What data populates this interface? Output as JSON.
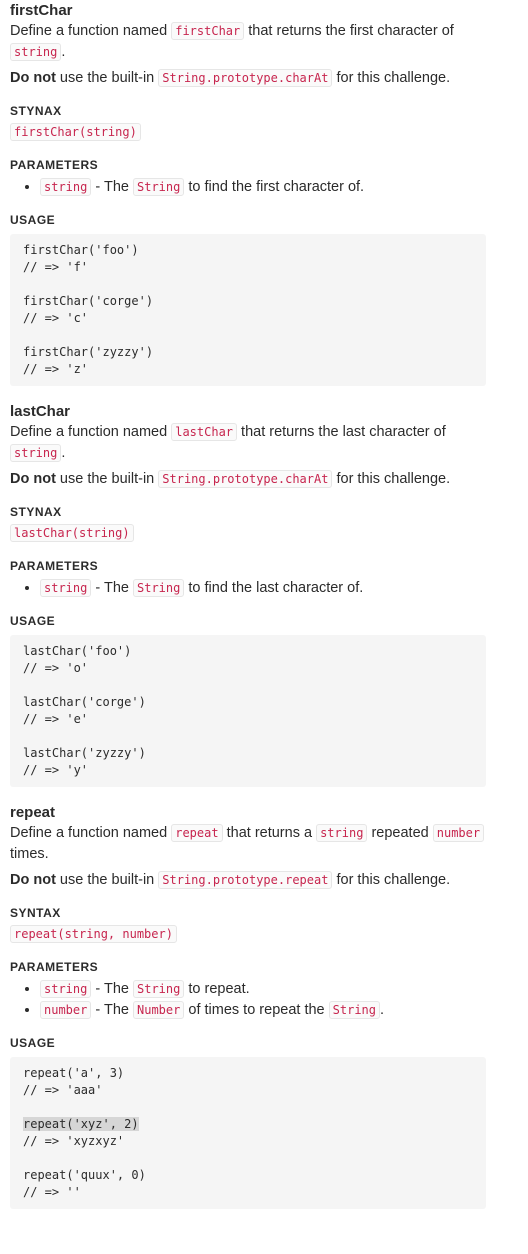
{
  "sections": [
    {
      "title": "firstChar",
      "desc_before": "Define a function named ",
      "desc_code1": "firstChar",
      "desc_mid": " that returns the first character of ",
      "desc_code2": "string",
      "desc_end": ".",
      "note_bold": "Do not",
      "note_before": " use the built-in ",
      "note_code": "String.prototype.charAt",
      "note_after": " for this challenge.",
      "syntax_label": "STYNAX",
      "syntax_code": "firstChar(string)",
      "params_label": "PARAMETERS",
      "params": [
        {
          "code": "string",
          "text1": " - The ",
          "code2": "String",
          "text2": " to find the first character of."
        }
      ],
      "usage_label": "USAGE",
      "usage_lines": [
        "firstChar('foo')",
        "// => 'f'",
        "",
        "firstChar('corge')",
        "// => 'c'",
        "",
        "firstChar('zyzzy')",
        "// => 'z'"
      ]
    },
    {
      "title": "lastChar",
      "desc_before": "Define a function named ",
      "desc_code1": "lastChar",
      "desc_mid": " that returns the last character of ",
      "desc_code2": "string",
      "desc_end": ".",
      "note_bold": "Do not",
      "note_before": " use the built-in ",
      "note_code": "String.prototype.charAt",
      "note_after": " for this challenge.",
      "syntax_label": "STYNAX",
      "syntax_code": "lastChar(string)",
      "params_label": "PARAMETERS",
      "params": [
        {
          "code": "string",
          "text1": " - The ",
          "code2": "String",
          "text2": " to find the last character of."
        }
      ],
      "usage_label": "USAGE",
      "usage_lines": [
        "lastChar('foo')",
        "// => 'o'",
        "",
        "lastChar('corge')",
        "// => 'e'",
        "",
        "lastChar('zyzzy')",
        "// => 'y'"
      ]
    },
    {
      "title": "repeat",
      "desc_before": "Define a function named ",
      "desc_code1": "repeat",
      "desc_mid": " that returns a ",
      "desc_code2": "string",
      "desc_mid2": " repeated ",
      "desc_code3": "number",
      "desc_end": " times.",
      "note_bold": "Do not",
      "note_before": " use the built-in ",
      "note_code": "String.prototype.repeat",
      "note_after": " for this challenge.",
      "syntax_label": "SYNTAX",
      "syntax_code": "repeat(string, number)",
      "params_label": "PARAMETERS",
      "params": [
        {
          "code": "string",
          "text1": " - The ",
          "code2": "String",
          "text2": " to repeat."
        },
        {
          "code": "number",
          "text1": " - The ",
          "code2": "Number",
          "text2": " of times to repeat the ",
          "code3": "String",
          "text3": "."
        }
      ],
      "usage_label": "USAGE",
      "usage_lines": [
        "repeat('a', 3)",
        "// => 'aaa'",
        "",
        "repeat('xyz', 2)",
        "// => 'xyzxyz'",
        "",
        "repeat('quux', 0)",
        "// => ''"
      ],
      "highlight_line": "repeat('xyz', 2)"
    }
  ]
}
